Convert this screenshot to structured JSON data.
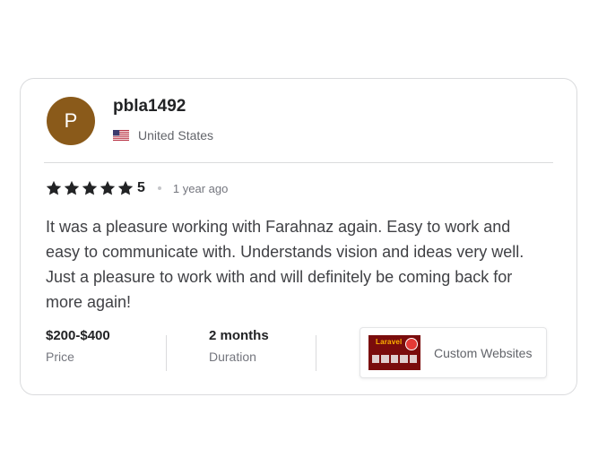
{
  "reviewer": {
    "avatar_letter": "P",
    "avatar_color": "#8a5a1a",
    "username": "pbla1492",
    "country": "United States",
    "flag_icon": "us-flag-icon"
  },
  "review": {
    "rating": "5",
    "rating_value": 5,
    "max_stars": 5,
    "star_icon": "star-icon",
    "time_ago": "1 year ago",
    "text": "It was a pleasure working with Farahnaz again. Easy to work and easy to communicate with. Understands vision and ideas very well. Just a pleasure to work with and will definitely be coming back for more again!"
  },
  "stats": {
    "price": {
      "value": "$200-$400",
      "label": "Price"
    },
    "duration": {
      "value": "2 months",
      "label": "Duration"
    }
  },
  "gig": {
    "title": "Custom Websites",
    "thumbnail_title": "Laravel",
    "thumbnail_color": "#7a0c0c"
  }
}
